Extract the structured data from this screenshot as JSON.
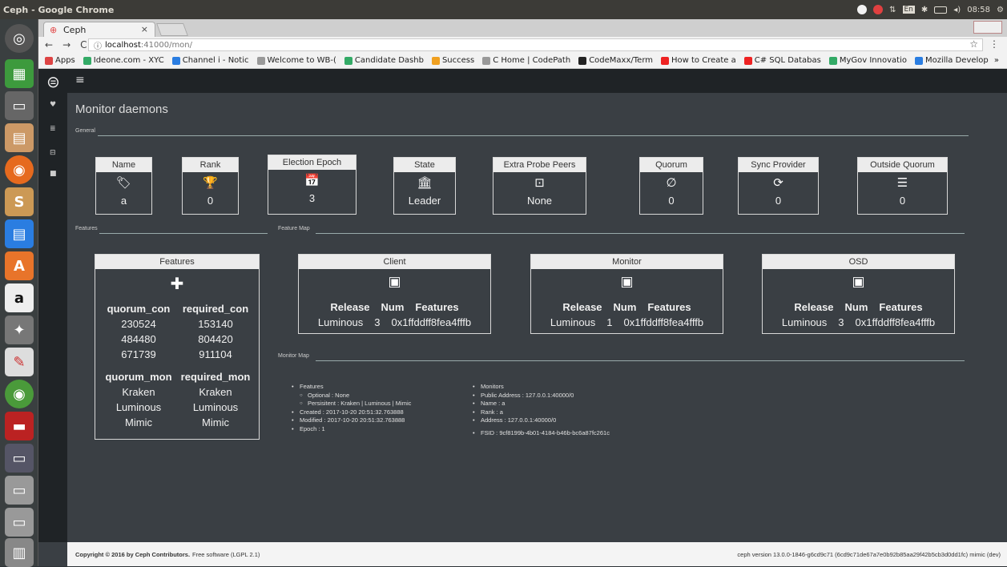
{
  "os": {
    "window_title": "Ceph - Google Chrome",
    "clock": "08:58",
    "lang": "En",
    "volume_icon": "volume-icon",
    "power_icon": "power-icon"
  },
  "launcher": {
    "amazon_letter": "a",
    "software_letter": "A"
  },
  "browser": {
    "tab_title": "Ceph",
    "tab_close": "×",
    "url_host": "localhost",
    "url_path": ":41000/mon/",
    "back_glyph": "←",
    "forward_glyph": "→",
    "reload_glyph": "C",
    "info_glyph": "ⓘ",
    "star_glyph": "☆",
    "menu_glyph": "⋮",
    "bookmarks": [
      {
        "label": "Apps",
        "color": "#d44"
      },
      {
        "label": "Ideone.com - XYC",
        "color": "#3a6"
      },
      {
        "label": "Channel i - Notic",
        "color": "#2a7de1"
      },
      {
        "label": "Welcome to WB-(",
        "color": "#999"
      },
      {
        "label": "Candidate Dashb",
        "color": "#3a6"
      },
      {
        "label": "Success",
        "color": "#f0a020"
      },
      {
        "label": "C Home | CodePath",
        "color": "#999"
      },
      {
        "label": "CodeMaxx/Term",
        "color": "#222"
      },
      {
        "label": "How to Create a",
        "color": "#e22"
      },
      {
        "label": "C# SQL Databas",
        "color": "#e22"
      },
      {
        "label": "MyGov Innovatio",
        "color": "#3a6"
      },
      {
        "label": "Mozilla Develop",
        "color": "#2a7de1"
      }
    ],
    "bookmarks_more": "»"
  },
  "app": {
    "hamburger": "≡",
    "page_title": "Monitor daemons",
    "sections": {
      "general": "General",
      "features": "Features",
      "feature_map": "Feature Map",
      "monitor_map": "Monitor Map"
    },
    "stats": [
      {
        "label": "Name",
        "icon": "tag-icon",
        "glyph": "🏷",
        "value": "a"
      },
      {
        "label": "Rank",
        "icon": "trophy-icon",
        "glyph": "🏆",
        "value": "0"
      },
      {
        "label": "Election Epoch",
        "icon": "calendar-icon",
        "glyph": "📅",
        "value": "3"
      },
      {
        "label": "State",
        "icon": "bank-icon",
        "glyph": "🏛",
        "value": "Leader"
      },
      {
        "label": "Extra Probe Peers",
        "icon": "dropdown-icon",
        "glyph": "⊡",
        "value": "None"
      },
      {
        "label": "Quorum",
        "icon": "empty-set-icon",
        "glyph": "∅",
        "value": "0"
      },
      {
        "label": "Sync Provider",
        "icon": "refresh-icon",
        "glyph": "⟳",
        "value": "0"
      },
      {
        "label": "Outside Quorum",
        "icon": "outdent-icon",
        "glyph": "☰",
        "value": "0"
      }
    ],
    "features_box": {
      "title": "Features",
      "icon": "puzzle-icon",
      "con_headers": [
        "quorum_con",
        "required_con"
      ],
      "con_rows": [
        [
          "230524",
          "153140"
        ],
        [
          "484480",
          "804420"
        ],
        [
          "671739",
          "911104"
        ]
      ],
      "mon_headers": [
        "quorum_mon",
        "required_mon"
      ],
      "mon_rows": [
        [
          "Kraken",
          "Kraken"
        ],
        [
          "Luminous",
          "Luminous"
        ],
        [
          "Mimic",
          "Mimic"
        ]
      ]
    },
    "releases": [
      {
        "title": "Client",
        "headers": [
          "Release",
          "Num",
          "Features"
        ],
        "values": [
          "Luminous",
          "3",
          "0x1ffddff8fea4fffb"
        ]
      },
      {
        "title": "Monitor",
        "headers": [
          "Release",
          "Num",
          "Features"
        ],
        "values": [
          "Luminous",
          "1",
          "0x1ffddff8fea4fffb"
        ]
      },
      {
        "title": "OSD",
        "headers": [
          "Release",
          "Num",
          "Features"
        ],
        "values": [
          "Luminous",
          "3",
          "0x1ffddff8fea4fffb"
        ]
      }
    ],
    "monitor_map": {
      "features": "Features",
      "optional": "Optional : None",
      "persistent": "Persisitent : Kraken | Luminous | Mimic",
      "created": "Created : 2017-10-20 20:51:32.763888",
      "modified": "Modified : 2017-10-20 20:51:32.763888",
      "epoch": "Epoch : 1",
      "monitors": "Monitors",
      "public_address": "Public Address : 127.0.0.1:40000/0",
      "name": "Name : a",
      "rank": "Rank : a",
      "address": "Address : 127.0.0.1:40000/0",
      "fsid": "FSID : 9cf8199b-4b01-4184-b46b-bc6a87fc261c"
    },
    "footer": {
      "copyright": "Copyright © 2016 by Ceph Contributors.",
      "license": "Free software (LGPL 2.1)",
      "version": "ceph version 13.0.0-1846-g6cd9c71 (6cd9c71de67a7e0b92b85aa29f42b5cb3d0dd1fc) mimic (dev)"
    }
  }
}
